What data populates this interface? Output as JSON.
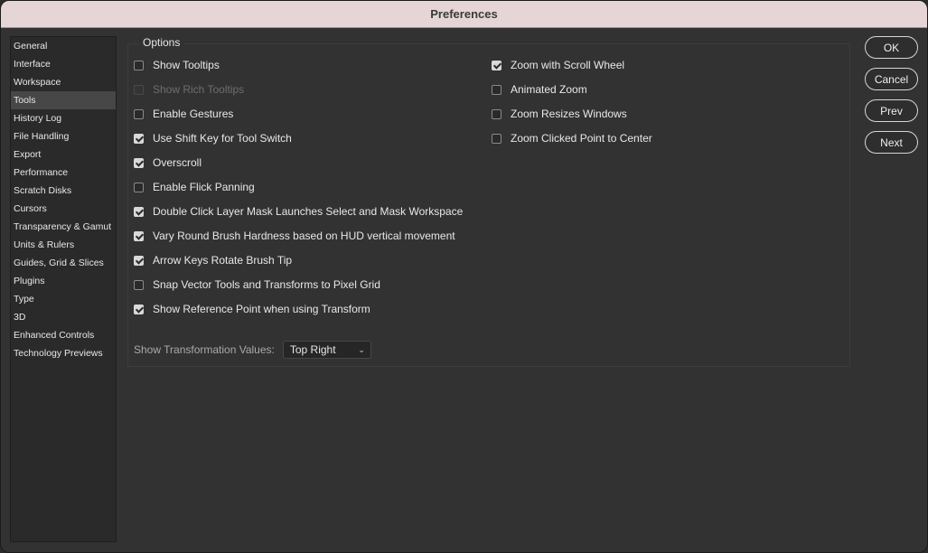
{
  "window": {
    "title": "Preferences"
  },
  "sidebar": {
    "selected": "Tools",
    "items": [
      {
        "label": "General"
      },
      {
        "label": "Interface"
      },
      {
        "label": "Workspace"
      },
      {
        "label": "Tools"
      },
      {
        "label": "History Log"
      },
      {
        "label": "File Handling"
      },
      {
        "label": "Export"
      },
      {
        "label": "Performance"
      },
      {
        "label": "Scratch Disks"
      },
      {
        "label": "Cursors"
      },
      {
        "label": "Transparency & Gamut"
      },
      {
        "label": "Units & Rulers"
      },
      {
        "label": "Guides, Grid & Slices"
      },
      {
        "label": "Plugins"
      },
      {
        "label": "Type"
      },
      {
        "label": "3D"
      },
      {
        "label": "Enhanced Controls"
      },
      {
        "label": "Technology Previews"
      }
    ]
  },
  "options": {
    "legend": "Options",
    "left": [
      {
        "label": "Show Tooltips",
        "checked": false,
        "disabled": false
      },
      {
        "label": "Show Rich Tooltips",
        "checked": false,
        "disabled": true
      },
      {
        "label": "Enable Gestures",
        "checked": false,
        "disabled": false
      },
      {
        "label": "Use Shift Key for Tool Switch",
        "checked": true,
        "disabled": false
      },
      {
        "label": "Overscroll",
        "checked": true,
        "disabled": false
      },
      {
        "label": "Enable Flick Panning",
        "checked": false,
        "disabled": false
      },
      {
        "label": "Double Click Layer Mask Launches Select and Mask Workspace",
        "checked": true,
        "disabled": false
      },
      {
        "label": "Vary Round Brush Hardness based on HUD vertical movement",
        "checked": true,
        "disabled": false
      },
      {
        "label": "Arrow Keys Rotate Brush Tip",
        "checked": true,
        "disabled": false
      },
      {
        "label": "Snap Vector Tools and Transforms to Pixel Grid",
        "checked": false,
        "disabled": false
      },
      {
        "label": "Show Reference Point when using Transform",
        "checked": true,
        "disabled": false
      }
    ],
    "right": [
      {
        "label": "Zoom with Scroll Wheel",
        "checked": true,
        "disabled": false
      },
      {
        "label": "Animated Zoom",
        "checked": false,
        "disabled": false
      },
      {
        "label": "Zoom Resizes Windows",
        "checked": false,
        "disabled": false
      },
      {
        "label": "Zoom Clicked Point to Center",
        "checked": false,
        "disabled": false
      }
    ],
    "transformation": {
      "label": "Show Transformation Values:",
      "value": "Top Right"
    }
  },
  "buttons": {
    "ok": "OK",
    "cancel": "Cancel",
    "prev": "Prev",
    "next": "Next"
  },
  "icons": {
    "checkbox_checked": "checkmark-icon",
    "select_caret": "chevron-down-icon"
  }
}
